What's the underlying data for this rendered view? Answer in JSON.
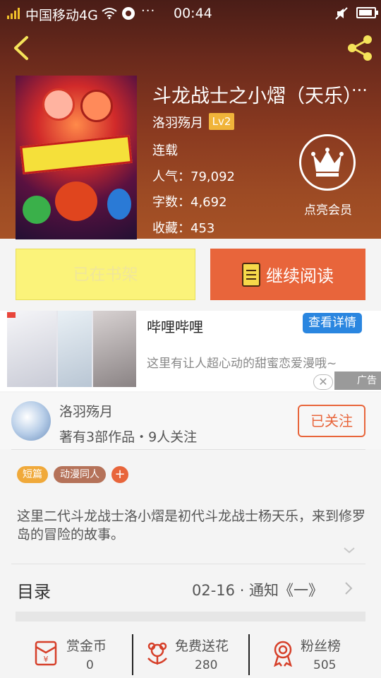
{
  "status_bar": {
    "carrier": "中国移动4G",
    "dots": "···",
    "time": "00:44"
  },
  "book": {
    "title": "斗龙战士之小熠（天乐）",
    "more": "···",
    "author": "洛羽殇月",
    "level": "Lv2",
    "status": "连载",
    "popularity": "人气：79,092",
    "word_count": "字数：4,692",
    "favorites": "收藏：453"
  },
  "vip": {
    "label": "点亮会员",
    "icon": "crown-icon"
  },
  "actions": {
    "shelf_label": "已在书架",
    "read_label": "继续阅读"
  },
  "ad": {
    "title": "哔哩哔哩",
    "details_label": "查看详情",
    "description": "这里有让人超心动的甜蜜恋爱漫哦~",
    "close": "✕",
    "mark": "广告"
  },
  "author_card": {
    "name": "洛羽殇月",
    "info": "著有3部作品・9人关注",
    "follow_label": "已关注"
  },
  "tags": [
    "短篇",
    "动漫同人",
    "+"
  ],
  "description": "这里二代斗龙战士洛小熠是初代斗龙战士杨天乐，来到修罗岛的冒险的故事。",
  "toc": {
    "label": "目录",
    "latest": "02-16 · 通知《一》"
  },
  "bottom_bar": [
    {
      "label": "赏金币",
      "value": "0",
      "icon": "red-envelope-icon"
    },
    {
      "label": "免费送花",
      "value": "280",
      "icon": "flower-icon"
    },
    {
      "label": "粉丝榜",
      "value": "505",
      "icon": "medal-icon"
    }
  ],
  "colors": {
    "accent": "#e8653b",
    "shelf_button": "#fbf37a",
    "level_badge": "#f0b43a",
    "ad_button": "#2a86e0"
  }
}
